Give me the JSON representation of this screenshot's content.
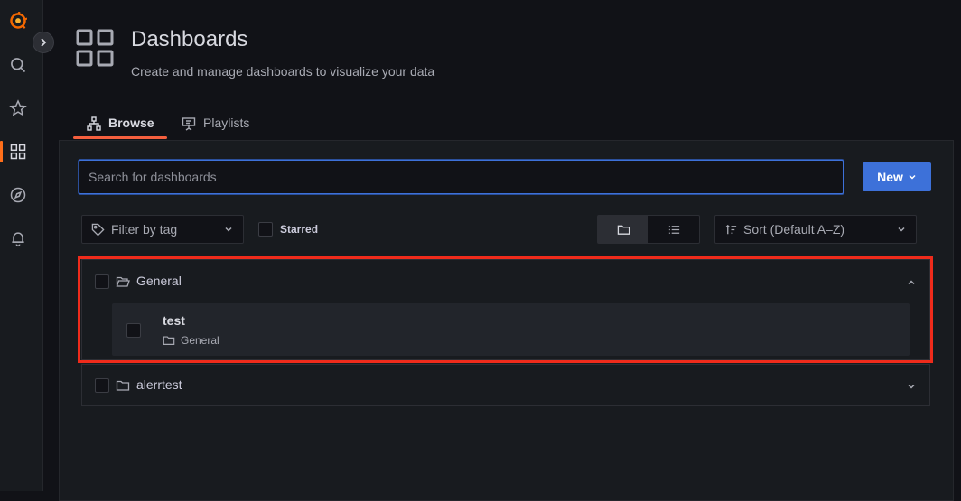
{
  "header": {
    "title": "Dashboards",
    "subtitle": "Create and manage dashboards to visualize your data"
  },
  "tabs": [
    {
      "label": "Browse",
      "active": true
    },
    {
      "label": "Playlists",
      "active": false
    }
  ],
  "search": {
    "placeholder": "Search for dashboards",
    "value": ""
  },
  "toolbar": {
    "new_label": "New",
    "filter_placeholder": "Filter by tag",
    "starred_label": "Starred",
    "sort_label": "Sort (Default A–Z)",
    "view_mode": "folders"
  },
  "folders": [
    {
      "name": "General",
      "expanded": true,
      "dashboards": [
        {
          "title": "test",
          "folder": "General"
        }
      ]
    },
    {
      "name": "alerrtest",
      "expanded": false,
      "dashboards": []
    }
  ],
  "colors": {
    "accent": "#3d71d9",
    "active_tab": "#f55f3e",
    "highlight": "#ef2b1b",
    "brand": "#f46800"
  },
  "icons": {
    "sidebar": [
      "grafana-logo-icon",
      "search-icon",
      "star-icon",
      "dashboards-grid-icon",
      "compass-icon",
      "bell-icon"
    ]
  }
}
